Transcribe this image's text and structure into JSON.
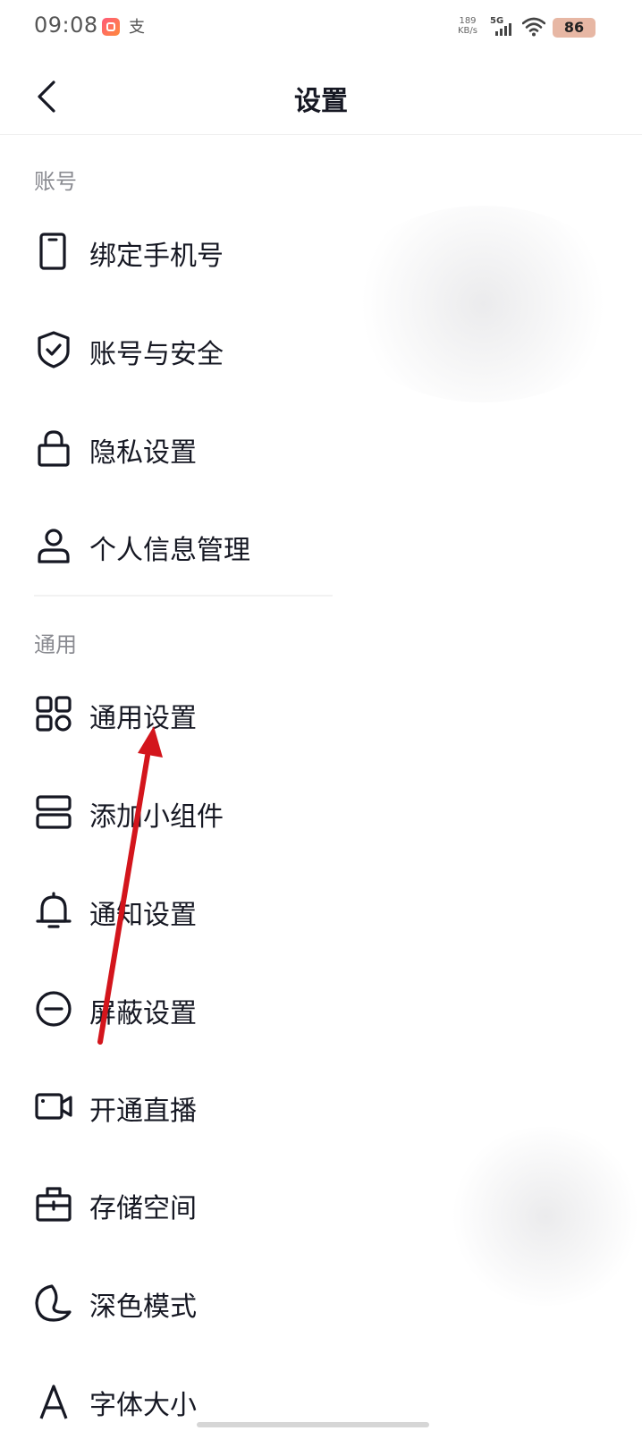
{
  "status_bar": {
    "time": "09:08",
    "app_icon_2": "支",
    "net_speed_value": "189",
    "net_speed_unit": "KB/s",
    "network_type": "5G",
    "battery_level": "86"
  },
  "header": {
    "title": "设置"
  },
  "sections": {
    "account": {
      "title": "账号",
      "items": [
        {
          "label": "绑定手机号",
          "icon": "phone-icon"
        },
        {
          "label": "账号与安全",
          "icon": "shield-check-icon"
        },
        {
          "label": "隐私设置",
          "icon": "lock-icon"
        },
        {
          "label": "个人信息管理",
          "icon": "person-icon"
        }
      ]
    },
    "general": {
      "title": "通用",
      "items": [
        {
          "label": "通用设置",
          "icon": "grid-icon"
        },
        {
          "label": "添加小组件",
          "icon": "widget-icon"
        },
        {
          "label": "通知设置",
          "icon": "bell-icon"
        },
        {
          "label": "屏蔽设置",
          "icon": "block-icon"
        },
        {
          "label": "开通直播",
          "icon": "video-camera-icon"
        },
        {
          "label": "存储空间",
          "icon": "storage-box-icon"
        },
        {
          "label": "深色模式",
          "icon": "moon-icon"
        },
        {
          "label": "字体大小",
          "icon": "font-size-icon"
        }
      ]
    }
  },
  "colors": {
    "text_primary": "#161823",
    "text_section": "#8a8b91",
    "annotation_arrow": "#d3151c"
  }
}
